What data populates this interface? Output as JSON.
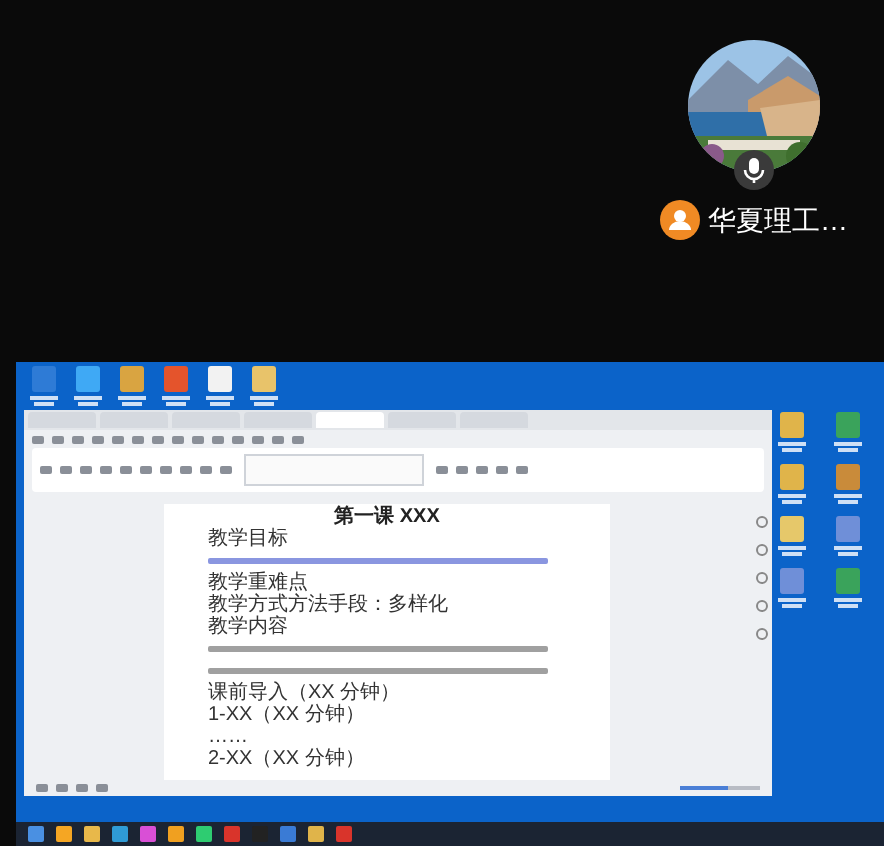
{
  "participant": {
    "name": "华夏理工…"
  },
  "shared_screen": {
    "desktop_icons_top": [
      {
        "color": "#2e7bd6"
      },
      {
        "color": "#3fa9f5"
      },
      {
        "color": "#d9a441"
      },
      {
        "color": "#e4542c"
      },
      {
        "color": "#f2f2f2"
      },
      {
        "color": "#e8c36a"
      }
    ],
    "desktop_icons_right": [
      {
        "color": "#e0b44a"
      },
      {
        "color": "#3aa35b"
      },
      {
        "color": "#e0b44a"
      },
      {
        "color": "#c98b3a"
      },
      {
        "color": "#e6c86a"
      },
      {
        "color": "#6f8fd8"
      },
      {
        "color": "#6f8fd8"
      },
      {
        "color": "#3aa35b"
      }
    ],
    "tabs": [
      {
        "selected": false
      },
      {
        "selected": false
      },
      {
        "selected": false
      },
      {
        "selected": false
      },
      {
        "selected": true
      },
      {
        "selected": false
      },
      {
        "selected": false
      }
    ],
    "document": {
      "title": "第一课 XXX",
      "lines": [
        {
          "kind": "text",
          "text": "教学目标"
        },
        {
          "kind": "blur",
          "color": "#8a96e0"
        },
        {
          "kind": "text",
          "text": "教学重难点"
        },
        {
          "kind": "text",
          "text": "教学方式方法手段：多样化"
        },
        {
          "kind": "text",
          "text": "教学内容"
        },
        {
          "kind": "blur",
          "color": "#a0a0a0"
        },
        {
          "kind": "blur",
          "color": "#a0a0a0"
        },
        {
          "kind": "text",
          "text": "课前导入（XX 分钟）"
        },
        {
          "kind": "text",
          "text": "1-XX（XX 分钟）"
        },
        {
          "kind": "text",
          "text": "……"
        },
        {
          "kind": "text",
          "text": "2-XX（XX 分钟）"
        }
      ]
    },
    "zoom": {
      "level": 0.6
    },
    "taskbar_items": [
      {
        "color": "#4a90e2"
      },
      {
        "color": "#f5a623"
      },
      {
        "color": "#e8b84a"
      },
      {
        "color": "#2f9bd6"
      },
      {
        "color": "#d94fd6"
      },
      {
        "color": "#f0a020"
      },
      {
        "color": "#2ecc71"
      },
      {
        "color": "#d9342b"
      },
      {
        "color": "#222222"
      },
      {
        "color": "#3a7bd5"
      },
      {
        "color": "#e0b44a"
      },
      {
        "color": "#d9342b"
      }
    ]
  }
}
